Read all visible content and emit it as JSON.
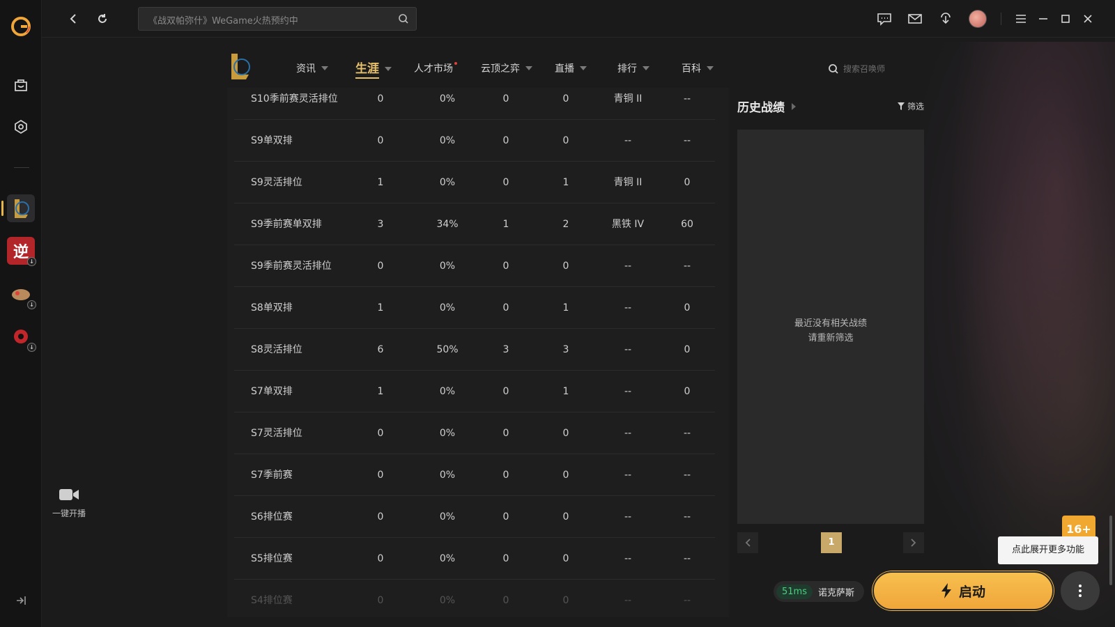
{
  "topbar": {
    "search_placeholder": "《战双帕弥什》WeGame火热预约中"
  },
  "gamenav": {
    "items": [
      {
        "label": "资讯"
      },
      {
        "label": "生涯"
      },
      {
        "label": "人才市场"
      },
      {
        "label": "云顶之弈"
      },
      {
        "label": "直播"
      },
      {
        "label": "排行"
      },
      {
        "label": "百科"
      }
    ],
    "search_placeholder": "搜索召唤师"
  },
  "table": {
    "rows": [
      {
        "name": "S10季前赛灵活排位",
        "c1": "0",
        "c2": "0%",
        "c3": "0",
        "c4": "0",
        "c5": "青铜 II",
        "c6": "--"
      },
      {
        "name": "S9单双排",
        "c1": "0",
        "c2": "0%",
        "c3": "0",
        "c4": "0",
        "c5": "--",
        "c6": "--"
      },
      {
        "name": "S9灵活排位",
        "c1": "1",
        "c2": "0%",
        "c3": "0",
        "c4": "1",
        "c5": "青铜 II",
        "c6": "0"
      },
      {
        "name": "S9季前赛单双排",
        "c1": "3",
        "c2": "34%",
        "c3": "1",
        "c4": "2",
        "c5": "黑铁 IV",
        "c6": "60"
      },
      {
        "name": "S9季前赛灵活排位",
        "c1": "0",
        "c2": "0%",
        "c3": "0",
        "c4": "0",
        "c5": "--",
        "c6": "--"
      },
      {
        "name": "S8单双排",
        "c1": "1",
        "c2": "0%",
        "c3": "0",
        "c4": "1",
        "c5": "--",
        "c6": "0"
      },
      {
        "name": "S8灵活排位",
        "c1": "6",
        "c2": "50%",
        "c3": "3",
        "c4": "3",
        "c5": "--",
        "c6": "0"
      },
      {
        "name": "S7单双排",
        "c1": "1",
        "c2": "0%",
        "c3": "0",
        "c4": "1",
        "c5": "--",
        "c6": "0"
      },
      {
        "name": "S7灵活排位",
        "c1": "0",
        "c2": "0%",
        "c3": "0",
        "c4": "0",
        "c5": "--",
        "c6": "--"
      },
      {
        "name": "S7季前赛",
        "c1": "0",
        "c2": "0%",
        "c3": "0",
        "c4": "0",
        "c5": "--",
        "c6": "--"
      },
      {
        "name": "S6排位赛",
        "c1": "0",
        "c2": "0%",
        "c3": "0",
        "c4": "0",
        "c5": "--",
        "c6": "--"
      },
      {
        "name": "S5排位赛",
        "c1": "0",
        "c2": "0%",
        "c3": "0",
        "c4": "0",
        "c5": "--",
        "c6": "--"
      },
      {
        "name": "S4排位赛",
        "c1": "0",
        "c2": "0%",
        "c3": "0",
        "c4": "0",
        "c5": "--",
        "c6": "--"
      }
    ]
  },
  "history": {
    "title": "历史战绩",
    "filter_label": "筛选",
    "empty_line1": "最近没有相关战绩",
    "empty_line2": "请重新筛选",
    "current_page": "1"
  },
  "live": {
    "label": "一键开播"
  },
  "bottom": {
    "ping": "51ms",
    "server": "诺克萨斯",
    "launch_label": "启动",
    "tooltip": "点此展开更多功能",
    "age_badge": "16+"
  },
  "colors": {
    "accent_gold": "#e8c16c",
    "launch_orange": "#f7c04e",
    "ping_green": "#4bd07f"
  }
}
